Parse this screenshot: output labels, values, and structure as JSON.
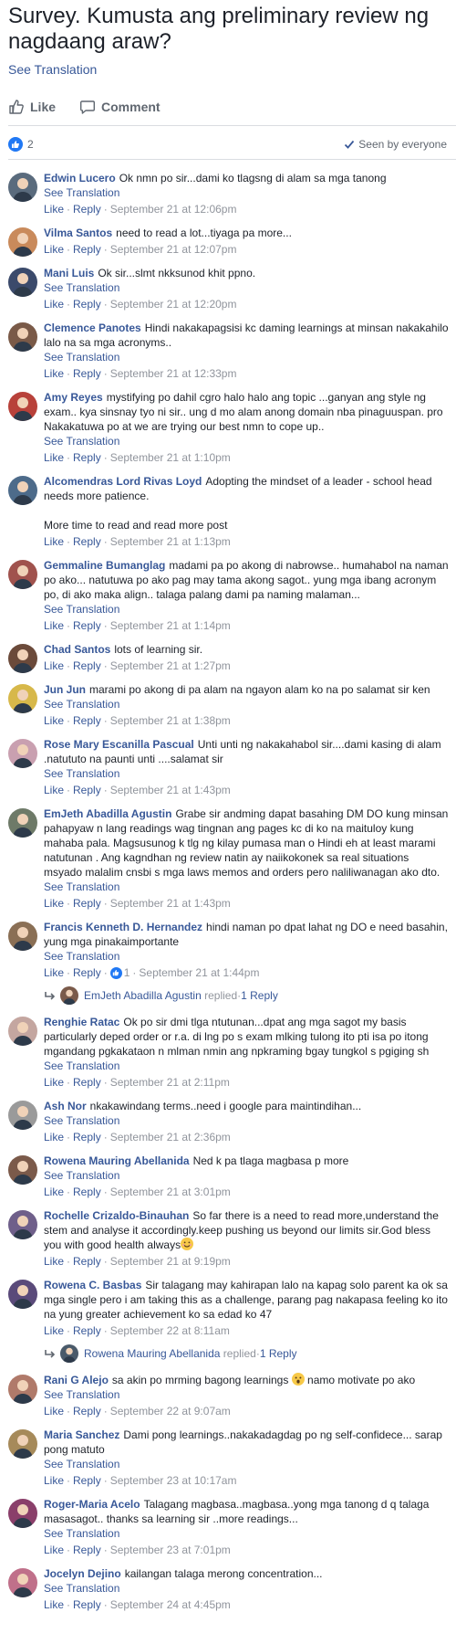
{
  "post": {
    "title": "Survey. Kumusta ang preliminary review ng nagdaang araw?",
    "see_translation": "See Translation"
  },
  "actions": {
    "like": "Like",
    "comment": "Comment"
  },
  "stats": {
    "like_count": "2",
    "seen": "Seen by everyone"
  },
  "labels": {
    "like": "Like",
    "reply": "Reply",
    "see_translation": "See Translation",
    "dot": "·"
  },
  "comments": [
    {
      "author": "Edwin Lucero",
      "text": "Ok nmn po sir...dami ko tlagsng di alam sa mga tanong",
      "time": "September 21 at 12:06pm",
      "translation": true
    },
    {
      "author": "Vilma Santos",
      "text": "need to read a lot...tiyaga pa more...",
      "time": "September 21 at 12:07pm",
      "translation": false
    },
    {
      "author": "Mani Luis",
      "text": "Ok sir...slmt nkksunod khit ppno.",
      "time": "September 21 at 12:20pm",
      "translation": true
    },
    {
      "author": "Clemence Panotes",
      "text": "Hindi nakakapagsisi kc daming learnings at minsan nakakahilo lalo na sa mga acronyms..",
      "time": "September 21 at 12:33pm",
      "translation": true
    },
    {
      "author": "Amy Reyes",
      "text": "mystifying po dahil cgro halo halo ang topic ...ganyan ang style ng exam.. kya sinsnay tyo ni sir.. ung d mo alam anong domain nba pinaguuspan. pro Nakakatuwa po at we are trying our best nmn to cope up..",
      "time": "September 21 at 1:10pm",
      "translation": true
    },
    {
      "author": "Alcomendras Lord Rivas Loyd",
      "text": "Adopting the mindset of a leader - school head needs more patience.",
      "text2": "More time to read and read more post",
      "time": "September 21 at 1:13pm",
      "translation": false
    },
    {
      "author": "Gemmaline Bumanglag",
      "text": "madami pa po akong di nabrowse.. humahabol na naman po ako... natutuwa po ako pag may tama akong sagot.. yung mga ibang acronym po, di ako maka align.. talaga palang dami pa naming malaman...",
      "time": "September 21 at 1:14pm",
      "translation": true
    },
    {
      "author": "Chad Santos",
      "text": "lots of learning sir.",
      "time": "September 21 at 1:27pm",
      "translation": false
    },
    {
      "author": "Jun Jun",
      "text": "marami po akong di pa alam na ngayon alam ko na po salamat sir ken",
      "time": "September 21 at 1:38pm",
      "translation": true
    },
    {
      "author": "Rose Mary Escanilla Pascual",
      "text": "Unti unti ng nakakahabol sir....dami kasing di alam .natututo na paunti unti ....salamat sir",
      "time": "September 21 at 1:43pm",
      "translation": true
    },
    {
      "author": "EmJeth Abadilla Agustin",
      "text": "Grabe sir andming dapat basahing DM DO kung minsan pahapyaw n lang readings wag tingnan ang pages kc di ko na maituloy kung mahaba pala. Magsusunog k tlg ng kilay pumasa man o Hindi eh at least marami natutunan . Ang kagndhan ng review natin ay naiikokonek sa real situations msyado malalim cnsbi s mga laws memos and orders pero naliliwanagan ako dto.",
      "time": "September 21 at 1:43pm",
      "translation": true
    },
    {
      "author": "Francis Kenneth D. Hernandez",
      "text": "hindi naman po dpat lahat ng DO e need basahin, yung mga pinakaimportante",
      "time": "September 21 at 1:44pm",
      "translation": true,
      "reactions": "1",
      "reply_by": "EmJeth Abadilla Agustin",
      "reply_text": "replied",
      "reply_count": "1 Reply"
    },
    {
      "author": "Renghie Ratac",
      "text": "Ok po sir dmi tlga ntutunan...dpat ang mga sagot my basis particularly deped order or r.a. di lng po s exam mlking tulong ito pti isa po itong mgandang pgkakataon n mlman nmin ang npkraming bgay tungkol s pgiging sh",
      "time": "September 21 at 2:11pm",
      "translation": true
    },
    {
      "author": "Ash Nor",
      "text": "nkakawindang terms..need i google para maintindihan...",
      "time": "September 21 at 2:36pm",
      "translation": true
    },
    {
      "author": "Rowena Mauring Abellanida",
      "text": "Ned k pa tlaga magbasa p more",
      "time": "September 21 at 3:01pm",
      "translation": true
    },
    {
      "author": "Rochelle Crizaldo-Binauhan",
      "text": "So far there is a need to read more,understand the stem and analyse it accordingly.keep pushing us beyond our limits sir.God bless you with good health always",
      "time": "September 21 at 9:19pm",
      "translation": false,
      "emoji": true
    },
    {
      "author": "Rowena C. Basbas",
      "text": "Sir talagang may kahirapan lalo na kapag solo parent ka ok sa mga single pero i am taking this as a challenge, parang pag nakapasa feeling ko ito na yung greater achievement ko sa edad ko 47",
      "time": "September 22 at 8:11am",
      "translation": false,
      "reply_by": "Rowena Mauring Abellanida",
      "reply_text": "replied",
      "reply_count": "1 Reply"
    },
    {
      "author": "Rani G Alejo",
      "text": "sa akin po mrming bagong learnings",
      "text_after": "namo motivate po ako",
      "time": "September 22 at 9:07am",
      "translation": true,
      "wow": true
    },
    {
      "author": "Maria Sanchez",
      "text": "Dami pong learnings..nakakadagdag po ng self-confidece... sarap pong matuto",
      "time": "September 23 at 10:17am",
      "translation": true
    },
    {
      "author": "Roger-Maria Acelo",
      "text": "Talagang magbasa..magbasa..yong mga tanong d q talaga masasagot.. thanks sa learning sir ..more readings...",
      "time": "September 23 at 7:01pm",
      "translation": true
    },
    {
      "author": "Jocelyn Dejino",
      "text": "kailangan talaga merong concentration...",
      "time": "September 24 at 4:45pm",
      "translation": true
    }
  ],
  "avatar_colors": [
    "#5a6b7d",
    "#c98a5b",
    "#3b4a6b",
    "#7a5a48",
    "#b8413a",
    "#4d6b8a",
    "#a0524d",
    "#6b4a3a",
    "#d7b84a",
    "#c9a0b0",
    "#6e7a68",
    "#8a6f55",
    "#c4a6a0",
    "#9a9a9a",
    "#7b5a4a",
    "#6f5f8a",
    "#5a4a7a",
    "#b07a6a",
    "#a68a5a",
    "#8a3f6a",
    "#c0708a"
  ],
  "reply_avatar_colors": [
    "#4a5a6a",
    "#7a5a4a"
  ],
  "accent": "#385898",
  "like_blue": "#2078f4"
}
